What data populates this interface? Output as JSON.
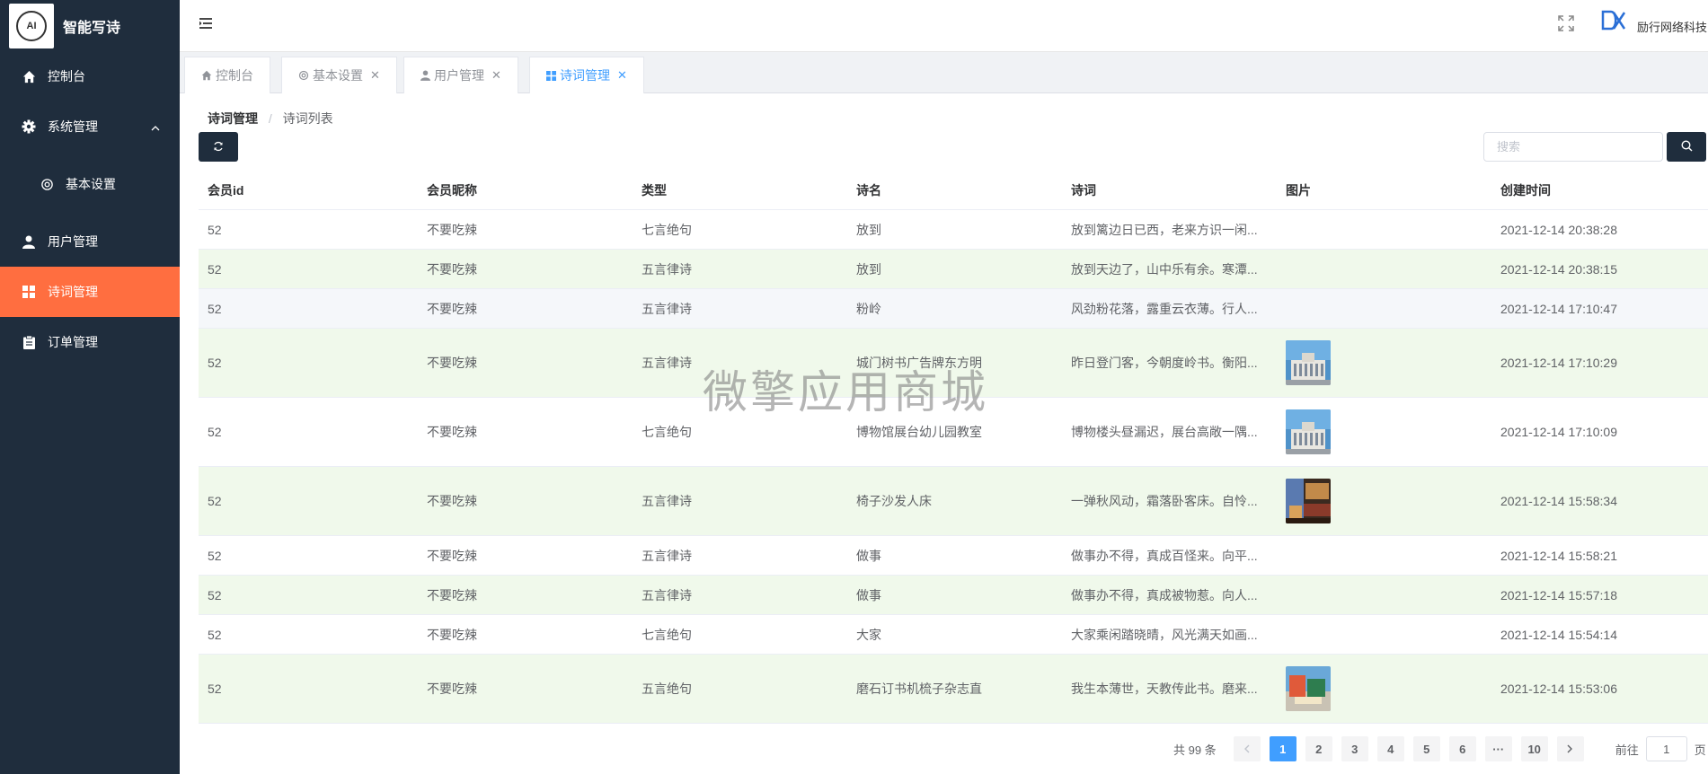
{
  "brand": {
    "logo_text": "AI",
    "name": "智能写诗"
  },
  "sidebar": {
    "items": [
      {
        "label": "控制台",
        "icon": "home-icon"
      },
      {
        "label": "系统管理",
        "icon": "gear-icon",
        "expanded": true
      },
      {
        "label": "基本设置",
        "icon": "settings-icon"
      },
      {
        "label": "用户管理",
        "icon": "user-icon"
      },
      {
        "label": "诗词管理",
        "icon": "grid-icon",
        "active": true
      },
      {
        "label": "订单管理",
        "icon": "clipboard-icon"
      }
    ]
  },
  "header": {
    "company_name": "励行网络科技"
  },
  "tabs": [
    {
      "label": "控制台",
      "icon": "home-icon"
    },
    {
      "label": "基本设置",
      "icon": "settings-icon"
    },
    {
      "label": "用户管理",
      "icon": "user-icon"
    },
    {
      "label": "诗词管理",
      "icon": "grid-icon",
      "active": true
    }
  ],
  "breadcrumb": {
    "parent": "诗词管理",
    "current": "诗词列表"
  },
  "search": {
    "placeholder": "搜索",
    "value": ""
  },
  "table": {
    "columns": [
      "会员id",
      "会员昵称",
      "类型",
      "诗名",
      "诗词",
      "图片",
      "创建时间"
    ],
    "rows": [
      {
        "id": "52",
        "nickname": "不要吃辣",
        "type": "七言绝句",
        "title": "放到",
        "poem": "放到篱边日已西，老来方识一闲...",
        "has_image": false,
        "time": "2021-12-14 20:38:28"
      },
      {
        "id": "52",
        "nickname": "不要吃辣",
        "type": "五言律诗",
        "title": "放到",
        "poem": "放到天边了，山中乐有余。寒潭...",
        "has_image": false,
        "time": "2021-12-14 20:38:15"
      },
      {
        "id": "52",
        "nickname": "不要吃辣",
        "type": "五言律诗",
        "title": "粉岭",
        "poem": "风劲粉花落，露重云衣薄。行人...",
        "has_image": false,
        "time": "2021-12-14 17:10:47"
      },
      {
        "id": "52",
        "nickname": "不要吃辣",
        "type": "五言律诗",
        "title": "城门树书广告牌东方明",
        "poem": "昨日登门客，今朝度岭书。衡阳...",
        "has_image": true,
        "image": "building-photo",
        "time": "2021-12-14 17:10:29"
      },
      {
        "id": "52",
        "nickname": "不要吃辣",
        "type": "七言绝句",
        "title": "博物馆展台幼儿园教室",
        "poem": "博物楼头昼漏迟，展台高敞一隅...",
        "has_image": true,
        "image": "building-photo",
        "time": "2021-12-14 17:10:09"
      },
      {
        "id": "52",
        "nickname": "不要吃辣",
        "type": "五言律诗",
        "title": "椅子沙发人床",
        "poem": "一弹秋风动，霜落卧客床。自怜...",
        "has_image": true,
        "image": "room-photo",
        "time": "2021-12-14 15:58:34"
      },
      {
        "id": "52",
        "nickname": "不要吃辣",
        "type": "五言律诗",
        "title": "做事",
        "poem": "做事办不得，真成百怪来。向平...",
        "has_image": false,
        "time": "2021-12-14 15:58:21"
      },
      {
        "id": "52",
        "nickname": "不要吃辣",
        "type": "五言律诗",
        "title": "做事",
        "poem": "做事办不得，真成被物惹。向人...",
        "has_image": false,
        "time": "2021-12-14 15:57:18"
      },
      {
        "id": "52",
        "nickname": "不要吃辣",
        "type": "七言绝句",
        "title": "大家",
        "poem": "大家乘闲踏晓晴，风光满天如画...",
        "has_image": false,
        "time": "2021-12-14 15:54:14"
      },
      {
        "id": "52",
        "nickname": "不要吃辣",
        "type": "五言绝句",
        "title": "磨石订书机梳子杂志直",
        "poem": "我生本薄世，天教传此书。磨来...",
        "has_image": true,
        "image": "desk-photo",
        "time": "2021-12-14 15:53:06"
      }
    ]
  },
  "pagination": {
    "total_text": "共 99 条",
    "pages": [
      "1",
      "2",
      "3",
      "4",
      "5",
      "6",
      "···",
      "10"
    ],
    "current": "1",
    "goto_prefix": "前往",
    "goto_value": "1",
    "goto_suffix": "页"
  },
  "watermark": "微擎应用商城",
  "colors": {
    "sidebar_bg": "#1f2d3d",
    "active_menu": "#ff6e40",
    "primary": "#409eff",
    "stripe": "#f0f9eb"
  }
}
